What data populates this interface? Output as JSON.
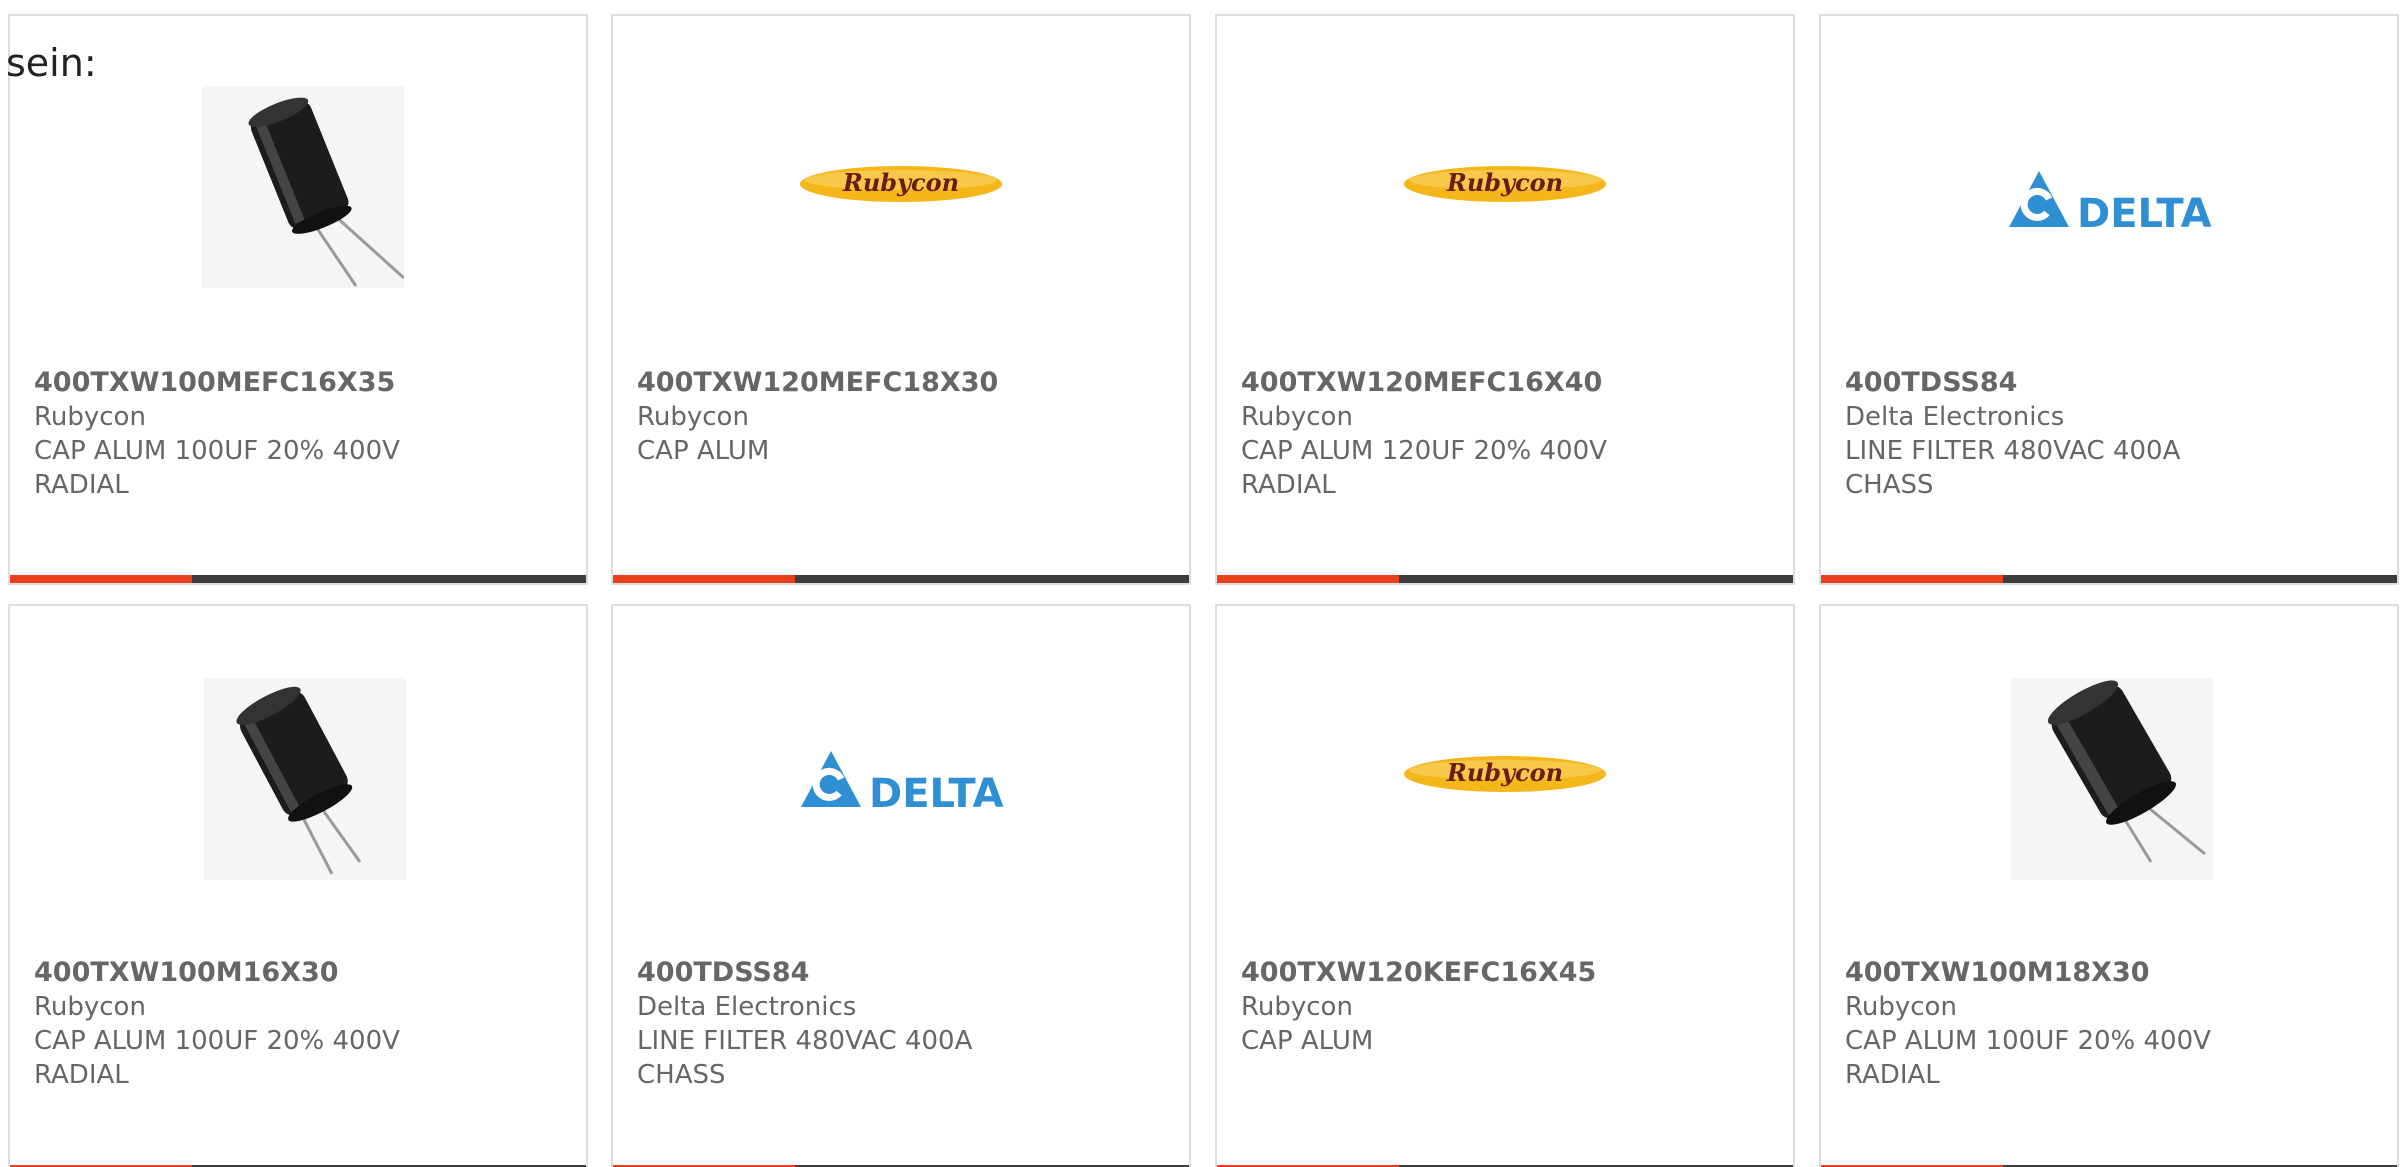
{
  "intro_text": "sein:",
  "colors": {
    "accent": "#e8401c",
    "bar": "#3d3d3d",
    "rubycon_yellow": "#f5b619",
    "rubycon_text": "#6b1d12",
    "delta_blue": "#2e8fd3"
  },
  "products": [
    {
      "image": "capacitor-upright",
      "part": "400TXW100MEFC16X35",
      "manufacturer": "Rubycon",
      "description": "CAP ALUM 100UF 20% 400V\nRADIAL"
    },
    {
      "image": "rubycon-logo",
      "logo_text": "Rubycon",
      "part": "400TXW120MEFC18X30",
      "manufacturer": "Rubycon",
      "description": "CAP ALUM"
    },
    {
      "image": "rubycon-logo",
      "logo_text": "Rubycon",
      "part": "400TXW120MEFC16X40",
      "manufacturer": "Rubycon",
      "description": "CAP ALUM 120UF 20% 400V\nRADIAL"
    },
    {
      "image": "delta-logo",
      "logo_text": "DELTA",
      "part": "400TDSS84",
      "manufacturer": "Delta Electronics",
      "description": "LINE FILTER 480VAC 400A\nCHASS"
    },
    {
      "image": "capacitor-tilted",
      "part": "400TXW100M16X30",
      "manufacturer": "Rubycon",
      "description": "CAP ALUM 100UF 20% 400V\nRADIAL"
    },
    {
      "image": "delta-logo",
      "logo_text": "DELTA",
      "part": "400TDSS84",
      "manufacturer": "Delta Electronics",
      "description": "LINE FILTER 480VAC 400A\nCHASS"
    },
    {
      "image": "rubycon-logo",
      "logo_text": "Rubycon",
      "part": "400TXW120KEFC16X45",
      "manufacturer": "Rubycon",
      "description": "CAP ALUM"
    },
    {
      "image": "capacitor-tilted",
      "part": "400TXW100M18X30",
      "manufacturer": "Rubycon",
      "description": "CAP ALUM 100UF 20% 400V\nRADIAL"
    }
  ]
}
